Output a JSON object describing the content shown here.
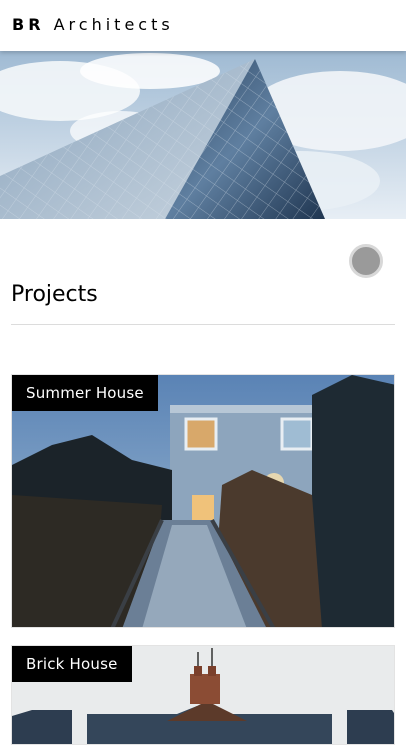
{
  "header": {
    "brand_bold": "BR",
    "brand_rest": "Architects"
  },
  "section": {
    "title": "Projects"
  },
  "projects": [
    {
      "label": "Summer House"
    },
    {
      "label": "Brick House"
    }
  ],
  "colors": {
    "sky": "#cfe0ee",
    "glass": "#3d5a7a",
    "fab": "#9a9a9a",
    "label_bg": "#000000"
  }
}
